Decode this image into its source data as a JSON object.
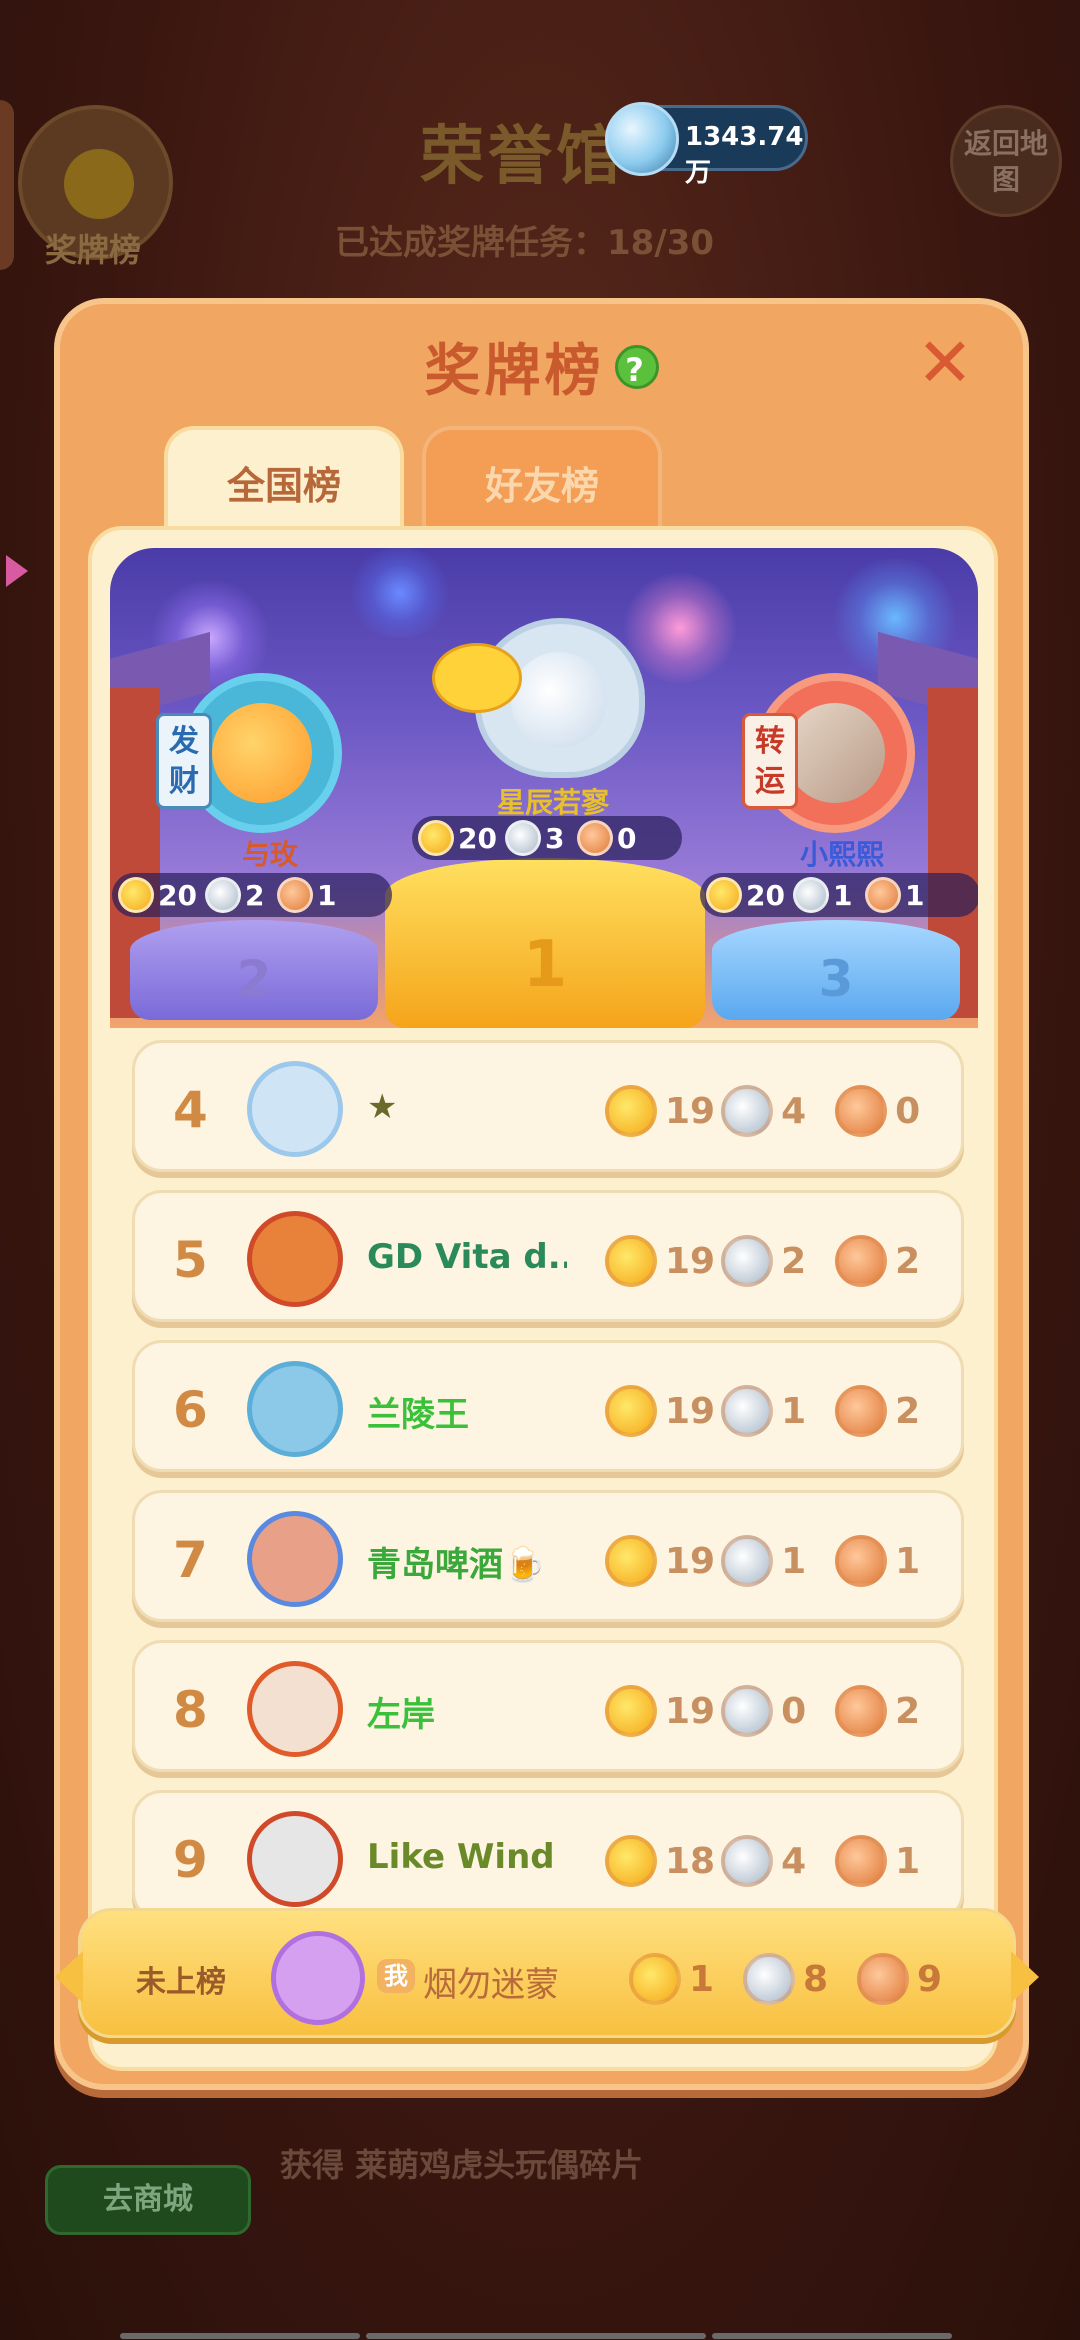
{
  "background": {
    "title": "荣誉馆",
    "progress_text": "已达成奖牌任务：18/30",
    "medal_board_label": "奖牌榜",
    "back_button": "返回地图",
    "coins": "1343.74万",
    "shop_button": "去商城",
    "reward_text": "获得 莱萌鸡虎头玩偶碎片"
  },
  "modal": {
    "title": "奖牌榜",
    "help": "?",
    "close": "✕",
    "tabs": {
      "national": "全国榜",
      "friends": "好友榜"
    }
  },
  "podium": {
    "first": {
      "rank": "1",
      "name": "星辰若寥",
      "gold": "20",
      "silver": "3",
      "bronze": "0"
    },
    "second": {
      "rank": "2",
      "name": "与玫",
      "tag": "发财",
      "gold": "20",
      "silver": "2",
      "bronze": "1"
    },
    "third": {
      "rank": "3",
      "name": "小熙熙",
      "tag": "转运",
      "gold": "20",
      "silver": "1",
      "bronze": "1"
    }
  },
  "rankings": [
    {
      "rank": "4",
      "name": "★",
      "name_color": "#6a6a2a",
      "gold": "19",
      "silver": "4",
      "bronze": "0"
    },
    {
      "rank": "5",
      "name": "GD Vita d...",
      "name_color": "#2a8a5a",
      "gold": "19",
      "silver": "2",
      "bronze": "2"
    },
    {
      "rank": "6",
      "name": "兰陵王",
      "name_color": "#3ac03a",
      "gold": "19",
      "silver": "1",
      "bronze": "2"
    },
    {
      "rank": "7",
      "name": "青岛啤酒🍺",
      "name_color": "#3aa83a",
      "gold": "19",
      "silver": "1",
      "bronze": "1"
    },
    {
      "rank": "8",
      "name": "左岸",
      "name_color": "#3ac03a",
      "gold": "19",
      "silver": "0",
      "bronze": "2"
    },
    {
      "rank": "9",
      "name": "Like Wind",
      "name_color": "#6a8a2a",
      "gold": "18",
      "silver": "4",
      "bronze": "1"
    }
  ],
  "my_rank": {
    "status": "未上榜",
    "me_tag": "我",
    "name": "烟勿迷蒙",
    "gold": "1",
    "silver": "8",
    "bronze": "9"
  }
}
